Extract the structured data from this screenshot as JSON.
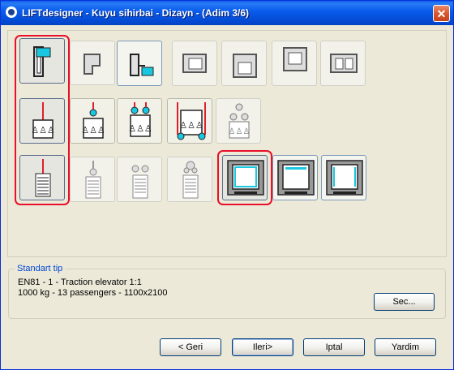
{
  "window": {
    "title": "LIFTdesigner - Kuyu sihirbai - Dizayn - (Adim 3/6)",
    "close_symbol": "✕"
  },
  "standard_type": {
    "label": "Standart tip",
    "line1": "EN81 - 1 - Traction elevator 1:1",
    "line2": "1000 kg - 13 passengers - 1100x2100",
    "select_button": "Sec..."
  },
  "buttons": {
    "back": "< Geri",
    "next": "Ileri>",
    "cancel": "Iptal",
    "help": "Yardim"
  },
  "colors": {
    "selection_outline": "#e8102a",
    "accent_cyan": "#19c7e0",
    "counterweight_red": "#e01f2c"
  },
  "design_options": {
    "rows": [
      {
        "name": "shaft-layout",
        "icons": [
          "shaft-single-car-top-icon",
          "shaft-l-shape-icon",
          "shaft-car-with-corner-icon",
          "shaft-door-left-icon",
          "shaft-door-bottom-icon",
          "shaft-door-top-icon",
          "shaft-double-car-icon"
        ]
      },
      {
        "name": "suspension",
        "icons": [
          "suspension-1to1-icon",
          "suspension-2to1-top-icon",
          "suspension-2to1-double-icon",
          "suspension-underslung-icon",
          "suspension-pulley-icon"
        ]
      },
      {
        "name": "counterweight-and-door",
        "icons": [
          "counterweight-1to1-icon",
          "counterweight-2to1-icon",
          "counterweight-double-icon",
          "counterweight-pulley-icon",
          "door-center-opening-icon",
          "door-top-opening-icon",
          "door-two-panel-icon"
        ]
      }
    ]
  }
}
